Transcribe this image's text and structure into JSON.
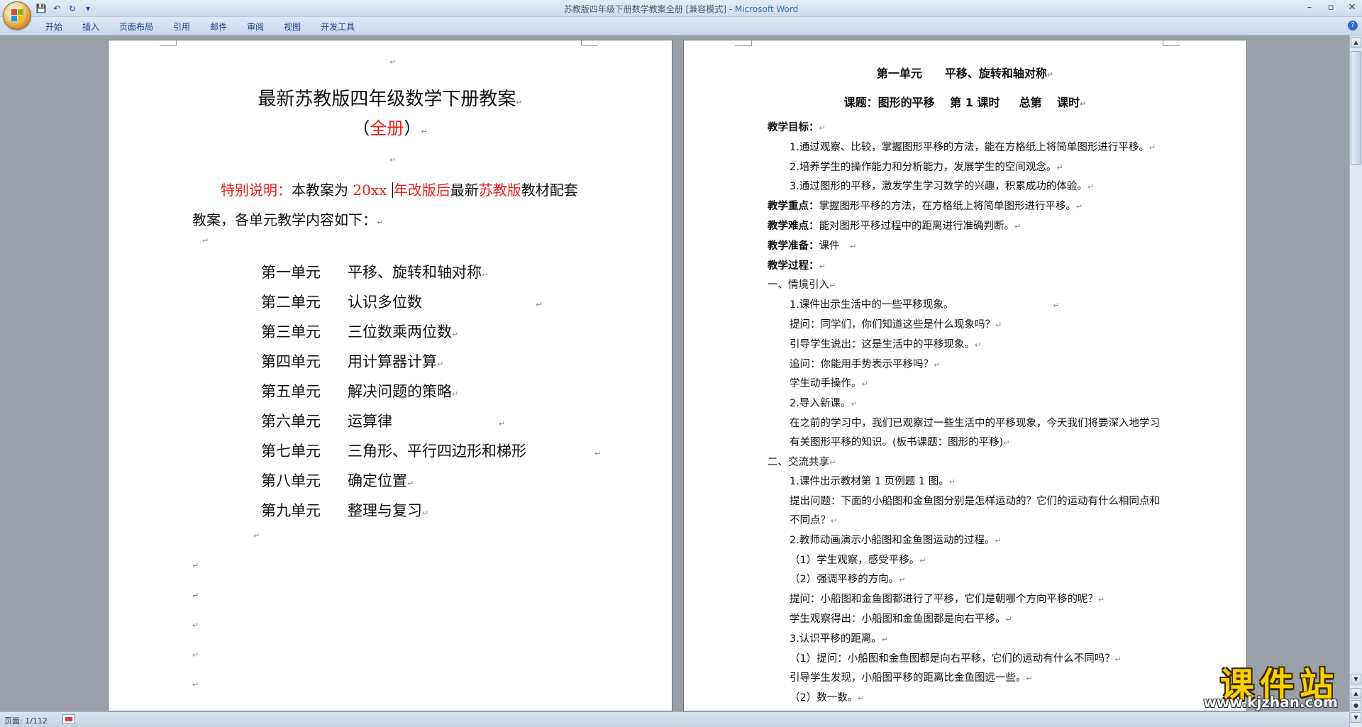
{
  "window": {
    "title": "苏教版四年级下册数学教案全册 [兼容模式] - ",
    "app_name": "Microsoft Word"
  },
  "quick_access": {
    "save": "💾",
    "undo": "↶",
    "redo": "↻",
    "more": "▾"
  },
  "window_buttons": {
    "minimize": "–",
    "maximize": "▫",
    "close": "✕"
  },
  "ribbon": {
    "tabs": [
      "开始",
      "插入",
      "页面布局",
      "引用",
      "邮件",
      "审阅",
      "视图",
      "开发工具"
    ],
    "help": "?"
  },
  "pilcrow": "↵",
  "left_page": {
    "title": "最新苏教版四年级数学下册教案",
    "subtitle_open": "（",
    "subtitle_red": "全册",
    "subtitle_close": "）",
    "note_label": "特别说明：",
    "note_t1": "本教案为",
    "note_year": " 20xx ",
    "note_red2": "年改版后",
    "note_t2": "最新",
    "note_red3": "苏教版",
    "note_t3": "教材配套教案，各单元教学内容如下：",
    "units": [
      {
        "no": "第一单元",
        "name": "平移、旋转和轴对称"
      },
      {
        "no": "第二单元",
        "name": "认识多位数"
      },
      {
        "no": "第三单元",
        "name": "三位数乘两位数"
      },
      {
        "no": "第四单元",
        "name": "用计算器计算"
      },
      {
        "no": "第五单元",
        "name": "解决问题的策略"
      },
      {
        "no": "第六单元",
        "name": "运算律"
      },
      {
        "no": "第七单元",
        "name": "三角形、平行四边形和梯形"
      },
      {
        "no": "第八单元",
        "name": "确定位置"
      },
      {
        "no": "第九单元",
        "name": "整理与复习"
      }
    ]
  },
  "right_page": {
    "heading": "第一单元　　平移、旋转和轴对称",
    "lesson": "课题：图形的平移　 第 1 课时 　 总第　 课时",
    "goals_label": "教学目标：",
    "goal1": "1.通过观察、比较，掌握图形平移的方法，能在方格纸上将简单图形进行平移。",
    "goal2": "2.培养学生的操作能力和分析能力，发展学生的空间观念。",
    "goal3": "3.通过图形的平移，激发学生学习数学的兴趣，积累成功的体验。",
    "key_label": "教学重点：",
    "key_text": "掌握图形平移的方法，在方格纸上将简单图形进行平移。",
    "difficult_label": "教学难点：",
    "difficult_text": "能对图形平移过程中的距离进行准确判断。",
    "prep_label": "教学准备：",
    "prep_text": "课件　",
    "process_label": "教学过程：",
    "s1": "一、情境引入",
    "s1_1": "1.课件出示生活中的一些平移现象。",
    "s1_2": "提问：同学们，你们知道这些是什么现象吗？",
    "s1_3": "引导学生说出：这是生活中的平移现象。",
    "s1_4": "追问：你能用手势表示平移吗？",
    "s1_5": "学生动手操作。",
    "s1_6": "2.导入新课。",
    "s1_7": "在之前的学习中，我们已观察过一些生活中的平移现象，今天我们将要深入地学习有关图形平移的知识。(板书课题：图形的平移)",
    "s2": "二、交流共享",
    "s2_1": "1.课件出示教材第 1 页例题 1 图。",
    "s2_2": "提出问题：下面的小船图和金鱼图分别是怎样运动的？它们的运动有什么相同点和不同点？",
    "s2_3": "2.教师动画演示小船图和金鱼图运动的过程。",
    "s2_4": "（1）学生观察，感受平移。",
    "s2_5": "（2）强调平移的方向。",
    "s2_6": "提问：小船图和金鱼图都进行了平移，它们是朝哪个方向平移的呢？",
    "s2_7": "学生观察得出：小船图和金鱼图都是向右平移。",
    "s2_8": "3.认识平移的距离。",
    "s2_9": "（1）提问：小船图和金鱼图都是向右平移，它们的运动有什么不同吗？",
    "s2_10": "引导学生发现，小船图平移的距离比金鱼图远一些。",
    "s2_11": "（2）数一数。"
  },
  "status": {
    "page": "页面: 1/112"
  },
  "watermark": {
    "cn": "课件站",
    "url": "www.kjzhan.com"
  }
}
